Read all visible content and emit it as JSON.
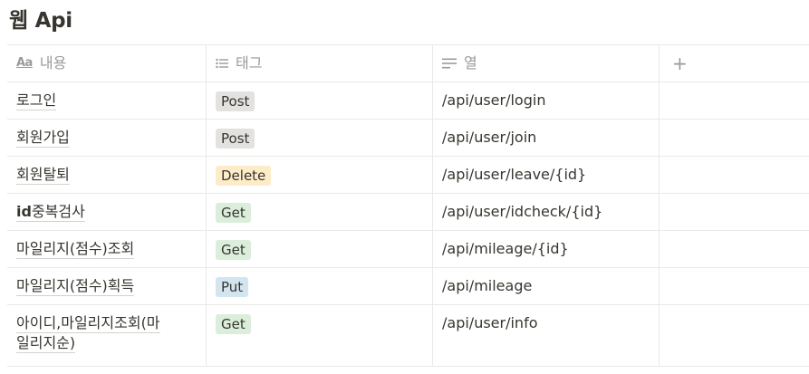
{
  "page": {
    "title": "웹 Api"
  },
  "table": {
    "columns": [
      {
        "icon": "aa-text-icon",
        "icon_text": "Aa",
        "label": "내용"
      },
      {
        "icon": "list-icon",
        "label": "태그"
      },
      {
        "icon": "text-lines-icon",
        "label": "열"
      },
      {
        "icon": "plus-icon",
        "icon_text": "+",
        "label": ""
      }
    ],
    "rows": [
      {
        "name": "로그인",
        "tag": "Post",
        "tag_color": "#e3e2e0",
        "path": "/api/user/login"
      },
      {
        "name": "회원가입",
        "tag": "Post",
        "tag_color": "#e3e2e0",
        "path": "/api/user/join"
      },
      {
        "name": "회원탈퇴",
        "tag": "Delete",
        "tag_color": "#fdecc8",
        "path": "/api/user/leave/{id}"
      },
      {
        "name_bold": "id",
        "name": "중복검사",
        "tag": "Get",
        "tag_color": "#dbeddb",
        "path": "/api/user/idcheck/{id}"
      },
      {
        "name": "마일리지(점수)조회",
        "tag": "Get",
        "tag_color": "#dbeddb",
        "path": "/api/mileage/{id}"
      },
      {
        "name": "마일리지(점수)획득",
        "tag": "Put",
        "tag_color": "#d3e5ef",
        "path": "/api/mileage"
      },
      {
        "name_line1": "아이디,마일리지조회(마",
        "name_line2": "일리지순)",
        "tag": "Get",
        "tag_color": "#dbeddb",
        "path": "/api/user/info"
      }
    ]
  }
}
